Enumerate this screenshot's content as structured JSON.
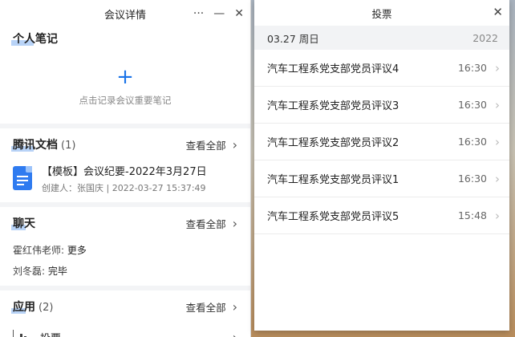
{
  "left": {
    "title": "会议详情",
    "controls": {
      "more": "···",
      "minimize": "—",
      "close": "✕"
    },
    "notes": {
      "title": "个人笔记",
      "plus": "+",
      "hint": "点击记录会议重要笔记"
    },
    "docs": {
      "title": "腾讯文档",
      "count": "(1)",
      "view_all": "查看全部",
      "items": [
        {
          "title": "【模板】会议纪要-2022年3月27日",
          "meta": "创建人：张国庆 | 2022-03-27 15:37:49"
        }
      ]
    },
    "chat": {
      "title": "聊天",
      "view_all": "查看全部",
      "lines": [
        {
          "sender": "霍红伟老师:",
          "text": "更多"
        },
        {
          "sender": "刘冬磊:",
          "text": "完毕"
        }
      ]
    },
    "apps": {
      "title": "应用",
      "count": "(2)",
      "view_all": "查看全部",
      "items": [
        {
          "label": "投票"
        }
      ]
    }
  },
  "right": {
    "title": "投票",
    "close": "✕",
    "date": "03.27 周日",
    "year": "2022",
    "votes": [
      {
        "name": "汽车工程系党支部党员评议4",
        "time": "16:30"
      },
      {
        "name": "汽车工程系党支部党员评议3",
        "time": "16:30"
      },
      {
        "name": "汽车工程系党支部党员评议2",
        "time": "16:30"
      },
      {
        "name": "汽车工程系党支部党员评议1",
        "time": "16:30"
      },
      {
        "name": "汽车工程系党支部党员评议5",
        "time": "15:48"
      }
    ]
  },
  "colors": {
    "accent": "#1a73e8",
    "doc_icon": "#2f7bf0",
    "title_highlight": "#a6c8f5"
  }
}
